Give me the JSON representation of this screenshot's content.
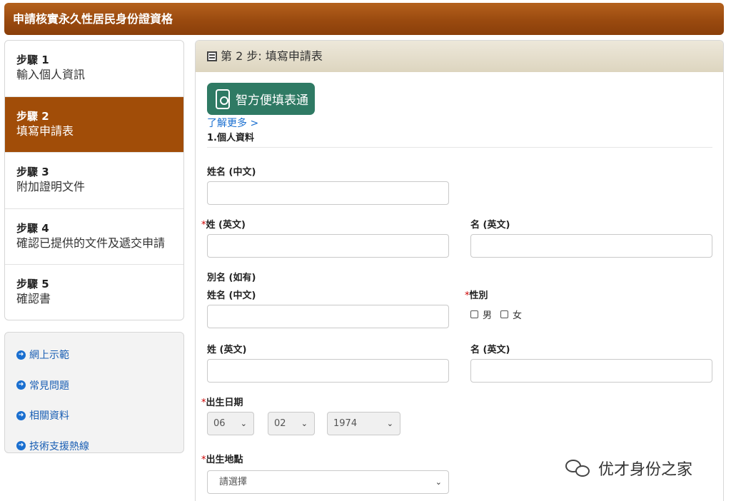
{
  "window_title": "申請核實永久性居民身份證資格",
  "steps": [
    {
      "no": "步驟 1",
      "name": "輸入個人資訊",
      "active": false
    },
    {
      "no": "步驟 2",
      "name": "填寫申請表",
      "active": true
    },
    {
      "no": "步驟 3",
      "name": "附加證明文件",
      "active": false
    },
    {
      "no": "步驟 4",
      "name": "確認已提供的文件及遞交申請",
      "active": false
    },
    {
      "no": "步驟 5",
      "name": "確認書",
      "active": false
    }
  ],
  "links": [
    {
      "label": "網上示範",
      "icon": "arrow-circle-right-icon"
    },
    {
      "label": "常見問題",
      "icon": "arrow-circle-right-icon"
    },
    {
      "label": "相關資料",
      "icon": "arrow-circle-right-icon"
    },
    {
      "label": "技術支援熱線",
      "icon": "arrow-circle-right-icon"
    }
  ],
  "panel": {
    "header": "第 2 步:  填寫申請表",
    "badge_label": "智方便填表通",
    "learn_more": "了解更多 >",
    "section_title": "1.個人資料"
  },
  "form": {
    "name_chinese": "姓名 (中文)",
    "surname_english": "姓 (英文)",
    "given_english": "名 (英文)",
    "alias_heading": "別名 (如有)",
    "alias_name_chinese": "姓名 (中文)",
    "sex": "性別",
    "sex_options": [
      "男",
      "女"
    ],
    "alias_surname_english": "姓 (英文)",
    "alias_given_english": "名 (英文)",
    "dob": "出生日期",
    "dob_day": "06",
    "dob_month": "02",
    "dob_year": "1974",
    "place_of_birth": "出生地點",
    "place_placeholder": "請選擇",
    "required_mark": "*"
  },
  "watermark": "优才身份之家",
  "colors": {
    "title_bar": "#9a4a0f",
    "active_step": "#a14d08",
    "badge": "#2f7a64",
    "link": "#1a5fb4",
    "required": "#cc0000"
  }
}
